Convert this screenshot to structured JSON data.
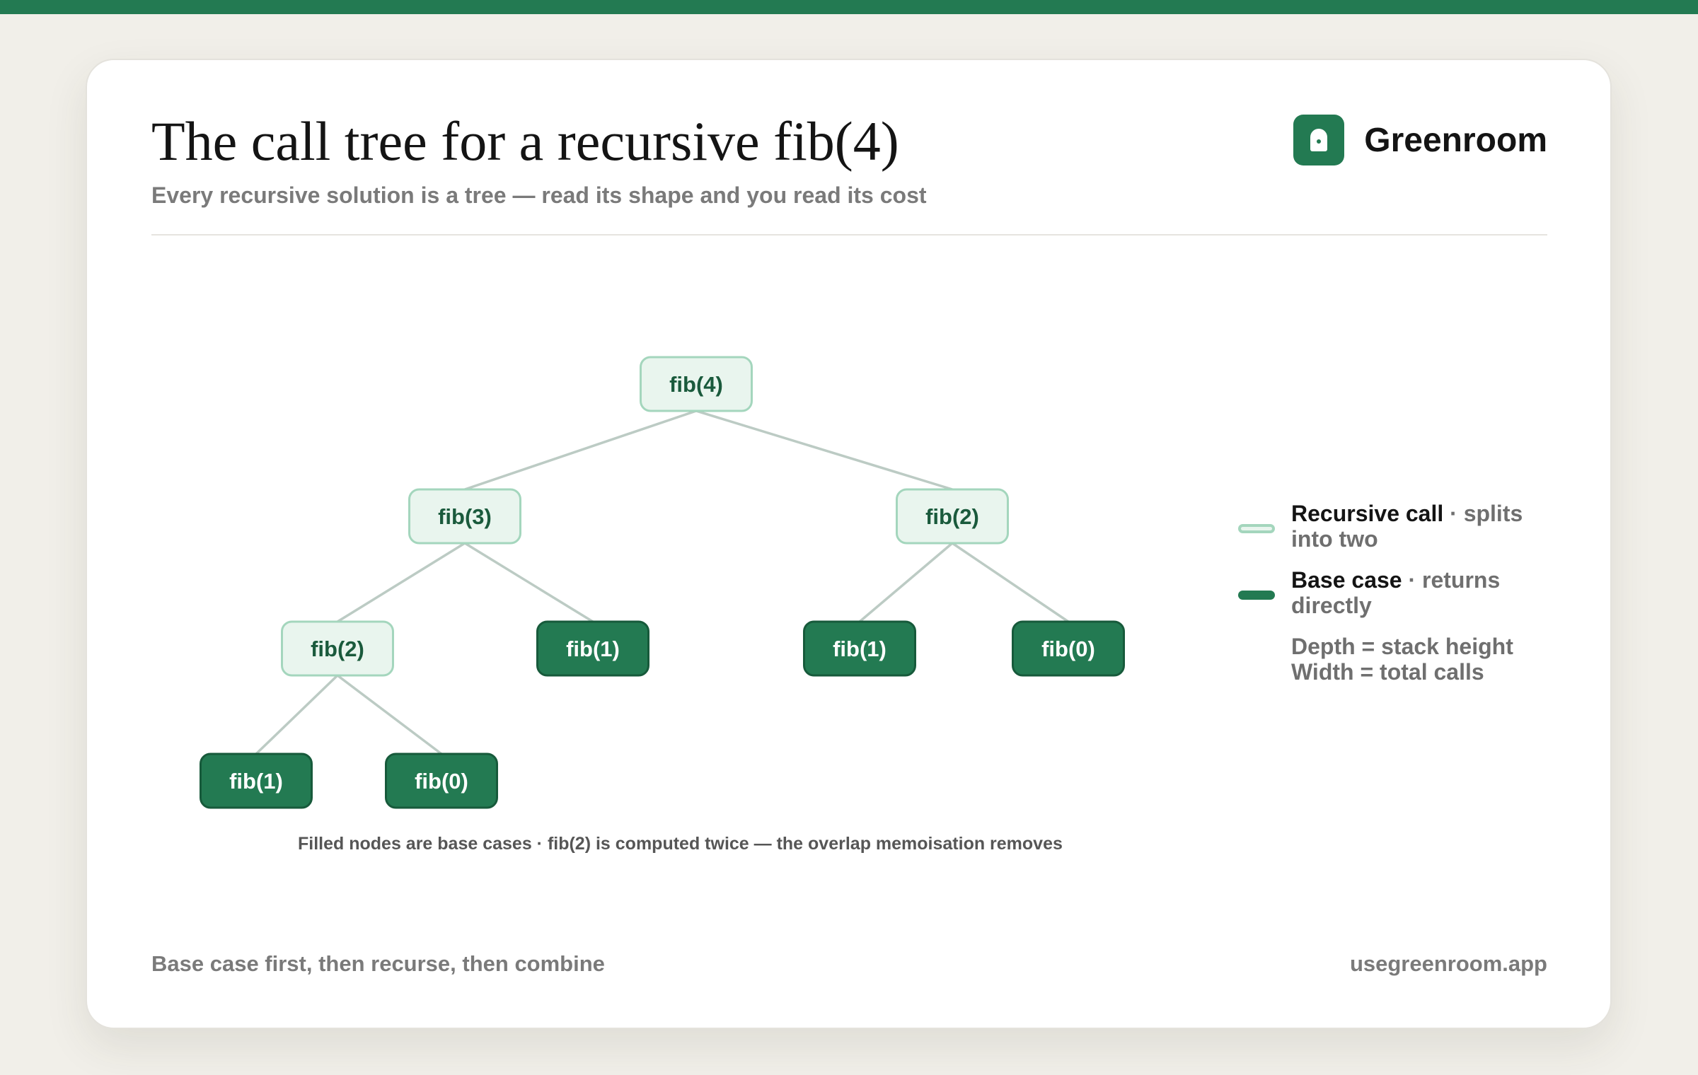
{
  "header": {
    "title": "The call tree for a recursive fib(4)",
    "subtitle": "Every recursive solution is a tree — read its shape and you read its cost"
  },
  "brand": {
    "name": "Greenroom",
    "logo_icon": "door-icon",
    "color": "#237a52"
  },
  "colors": {
    "recursive_fill": "#e9f5ee",
    "recursive_border": "#a4d6bd",
    "recursive_text": "#1a5a3c",
    "base_fill": "#237a52",
    "base_border": "#175a3b",
    "base_text": "#ffffff",
    "edge": "#bccbc4"
  },
  "tree": {
    "root": {
      "label": "fib(4)",
      "type": "recursive",
      "children": [
        {
          "label": "fib(3)",
          "type": "recursive",
          "children": [
            {
              "label": "fib(2)",
              "type": "recursive",
              "children": [
                {
                  "label": "fib(1)",
                  "type": "base"
                },
                {
                  "label": "fib(0)",
                  "type": "base"
                }
              ]
            },
            {
              "label": "fib(1)",
              "type": "base"
            }
          ]
        },
        {
          "label": "fib(2)",
          "type": "recursive",
          "children": [
            {
              "label": "fib(1)",
              "type": "base"
            },
            {
              "label": "fib(0)",
              "type": "base"
            }
          ]
        }
      ]
    },
    "caption": "Filled nodes are base cases · fib(2) is computed twice — the overlap memoisation removes"
  },
  "legend": {
    "recursive": {
      "label": "Recursive call",
      "description": "· splits into two"
    },
    "base": {
      "label": "Base case",
      "description": "· returns directly"
    },
    "notes": [
      "Depth = stack height",
      "Width = total calls"
    ]
  },
  "footer": {
    "left": "Base case first, then recurse, then combine",
    "right": "usegreenroom.app"
  }
}
